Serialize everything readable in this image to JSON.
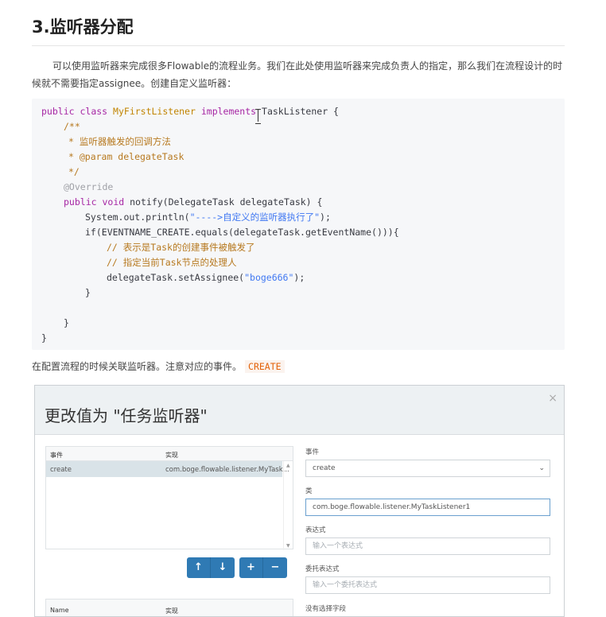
{
  "heading": "3.监听器分配",
  "paragraph": "可以使用监听器来完成很多Flowable的流程业务。我们在此处使用监听器来完成负责人的指定，那么我们在流程设计的时候就不需要指定assignee。创建自定义监听器：",
  "code": {
    "line1": {
      "kw1": "public",
      "kw2": "class",
      "cls": "MyFirstListener",
      "kw3": "implements",
      "rest": "TaskListener {"
    },
    "line2": "/**",
    "line3": "* 监听器触发的回调方法",
    "line4": "* @param delegateTask",
    "line5": "*/",
    "line6": "@Override",
    "line7": {
      "kw1": "public",
      "kw2": "void",
      "rest": "notify(DelegateTask delegateTask) {"
    },
    "line8": {
      "pre": "System.out.println(",
      "str": "\"---->自定义的监听器执行了\"",
      "post": ");"
    },
    "line9": "if(EVENTNAME_CREATE.equals(delegateTask.getEventName())){",
    "line10": "// 表示是Task的创建事件被触发了",
    "line11": "// 指定当前Task节点的处理人",
    "line12": {
      "pre": "delegateTask.setAssignee(",
      "str": "\"boge666\"",
      "post": ");"
    },
    "line13": "}",
    "line14": "}",
    "line15": "}"
  },
  "caption": {
    "text": "在配置流程的时候关联监听器。注意对应的事件。",
    "code": "CREATE"
  },
  "dialog": {
    "title": "更改值为 \"任务监听器\"",
    "close": "×",
    "grid": {
      "col1": "事件",
      "col2": "实现",
      "rows": [
        {
          "event": "create",
          "impl": "com.boge.flowable.listener.MyTask..."
        }
      ]
    },
    "buttons": {
      "up": "↑",
      "down": "↓",
      "add": "+",
      "remove": "−"
    },
    "grid2": {
      "col1": "Name",
      "col2": "实现"
    },
    "form": {
      "event_label": "事件",
      "event_value": "create",
      "class_label": "类",
      "class_value": "com.boge.flowable.listener.MyTaskListener1",
      "expression_label": "表达式",
      "expression_placeholder": "输入一个表达式",
      "delegate_label": "委托表达式",
      "delegate_placeholder": "输入一个委托表达式",
      "no_field": "没有选择字段"
    }
  }
}
